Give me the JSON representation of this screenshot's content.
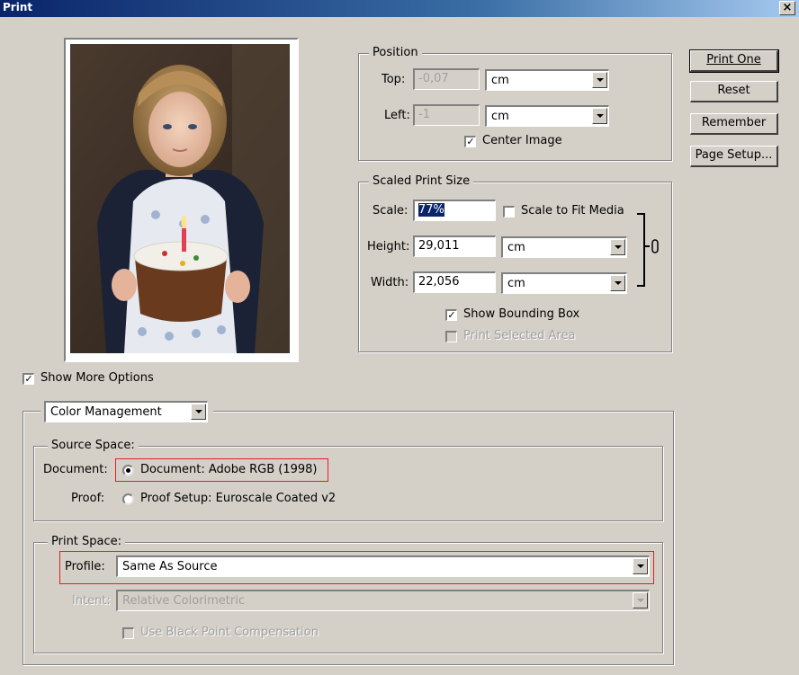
{
  "window": {
    "title": "Print",
    "close_glyph": "×"
  },
  "buttons": {
    "print_one": "Print One",
    "reset": "Reset",
    "remember": "Remember",
    "page_setup": "Page Setup..."
  },
  "position": {
    "legend": "Position",
    "top_label": "Top:",
    "top_value": "-0,07",
    "top_unit": "cm",
    "left_label": "Left:",
    "left_value": "-1",
    "left_unit": "cm",
    "center_image_label": "Center Image",
    "center_image_checked": true
  },
  "scaled": {
    "legend": "Scaled Print Size",
    "scale_label": "Scale:",
    "scale_value": "77%",
    "scale_to_fit_label": "Scale to Fit Media",
    "height_label": "Height:",
    "height_value": "29,011",
    "height_unit": "cm",
    "width_label": "Width:",
    "width_value": "22,056",
    "width_unit": "cm",
    "show_bounding_box_label": "Show Bounding Box",
    "print_selected_area_label": "Print Selected Area"
  },
  "more": {
    "show_more_options_label": "Show More Options",
    "section_select": "Color Management"
  },
  "source": {
    "legend": "Source Space:",
    "document_label": "Document:",
    "document_option": "Document:  Adobe RGB (1998)",
    "proof_label": "Proof:",
    "proof_option": "Proof Setup:  Euroscale Coated v2"
  },
  "printspace": {
    "legend": "Print Space:",
    "profile_label": "Profile:",
    "profile_value": "Same As Source",
    "intent_label": "Intent:",
    "intent_value": "Relative Colorimetric",
    "black_point_label": "Use Black Point Compensation"
  },
  "colors": {
    "highlight": "#e02020",
    "selection": "#0a246a",
    "face": "#d4d0c8"
  },
  "icons": {
    "link": "chain-link-icon",
    "photo": "girl-with-cake-photo"
  }
}
